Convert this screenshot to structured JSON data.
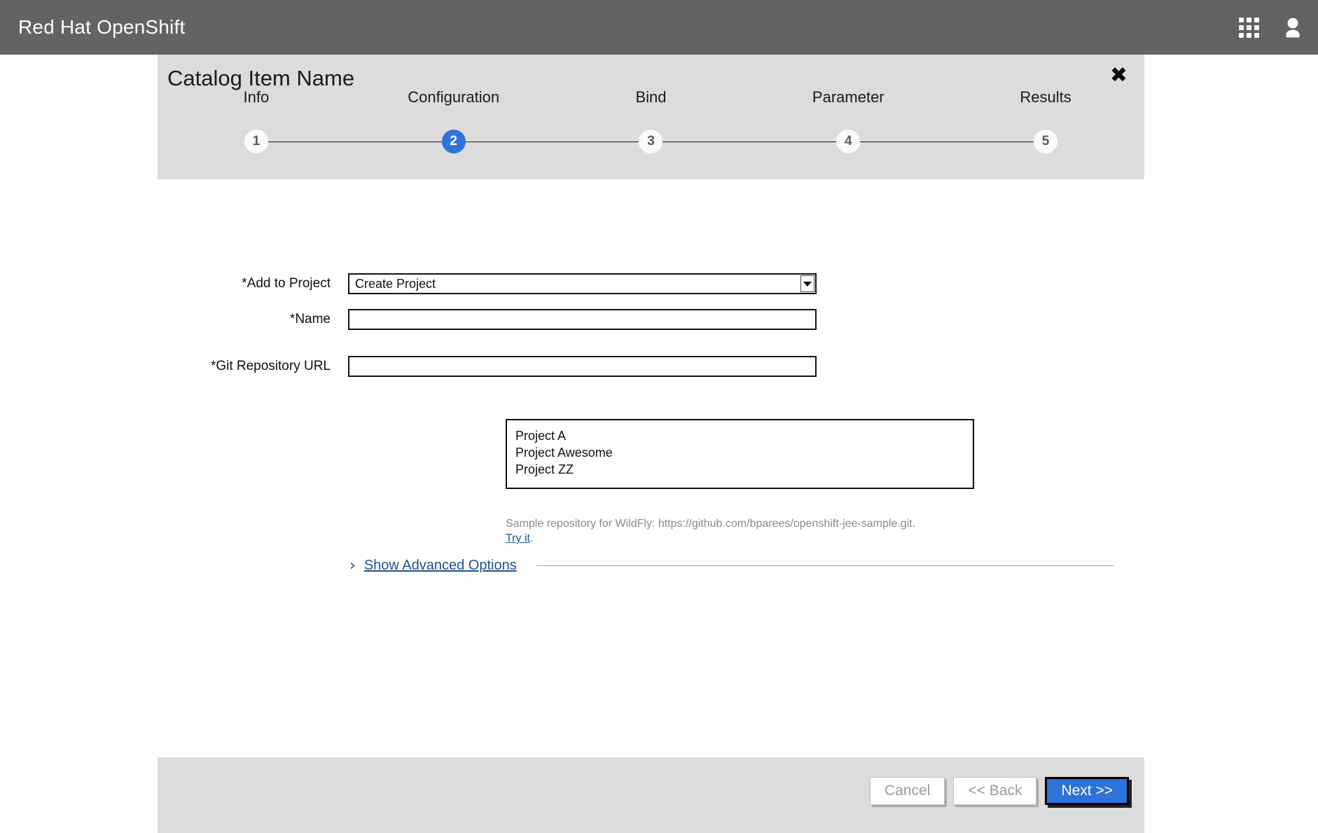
{
  "masthead": {
    "brand": "Red Hat OpenShift",
    "apps_icon": "grid-icon",
    "user_icon": "user-avatar-icon"
  },
  "panel": {
    "title": "Catalog Item Name",
    "close_label": "✖"
  },
  "wizard": {
    "steps": [
      {
        "number": "1",
        "label": "Info",
        "active": false
      },
      {
        "number": "2",
        "label": "Configuration",
        "active": true
      },
      {
        "number": "3",
        "label": "Bind",
        "active": false
      },
      {
        "number": "4",
        "label": "Parameter",
        "active": false
      },
      {
        "number": "5",
        "label": "Results",
        "active": false
      }
    ],
    "active_step": 2,
    "active_color": "#2f73d8",
    "inactive_color": "#fbfbfb"
  },
  "form": {
    "add_to_project": {
      "label": "*Add to Project",
      "value": "Create Project",
      "expanded": true,
      "arrow_icon": "chevron-down-icon",
      "options": [
        "Project A",
        "Project Awesome",
        "Project ZZ"
      ]
    },
    "name": {
      "label": "*Name",
      "value": "",
      "placeholder": ""
    },
    "git_repository_url": {
      "label": "*Git Repository URL",
      "value": "",
      "placeholder": "",
      "help_text": "Sample repository for WildFly: https://github.com/bparees/openshift-jee-sample.git.",
      "help_link_text": "Try it",
      "help_link_suffix": "."
    },
    "advanced": {
      "chevron_icon": "chevron-right-icon",
      "link_text": "Show Advanced Options"
    }
  },
  "footer": {
    "cancel_label": "Cancel",
    "back_label": "<< Back",
    "next_label": "Next >>"
  },
  "colors": {
    "masthead_bg": "#636363",
    "panel_header_bg": "#dcdcdc",
    "primary_blue": "#2f73d8",
    "link_blue": "#21508f",
    "help_grey": "#8a8a8a"
  }
}
